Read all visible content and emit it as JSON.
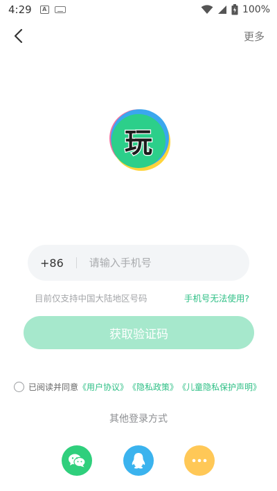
{
  "status_bar": {
    "time": "4:29",
    "app_icon_letter": "A",
    "battery": "100%"
  },
  "nav": {
    "more_label": "更多"
  },
  "logo": {
    "character": "玩"
  },
  "phone": {
    "country_code": "+86",
    "placeholder": "请输入手机号",
    "value": ""
  },
  "hint": {
    "support_text": "目前仅支持中国大陆地区号码",
    "unusable_link": "手机号无法使用?"
  },
  "get_code_button": "获取验证码",
  "agreement": {
    "prefix": "已阅读并同意",
    "user_agreement": "《用户协议》",
    "privacy_policy": "《隐私政策》",
    "child_privacy": "《儿童隐私保护声明》"
  },
  "other_login": {
    "title": "其他登录方式",
    "methods": [
      "wechat-icon",
      "qq-icon",
      "more-icon"
    ]
  },
  "colors": {
    "accent": "#2dbf85",
    "button_disabled": "#a6e8cc",
    "wechat": "#2fcf7c",
    "qq": "#3bb3ee",
    "more": "#ffc857"
  }
}
